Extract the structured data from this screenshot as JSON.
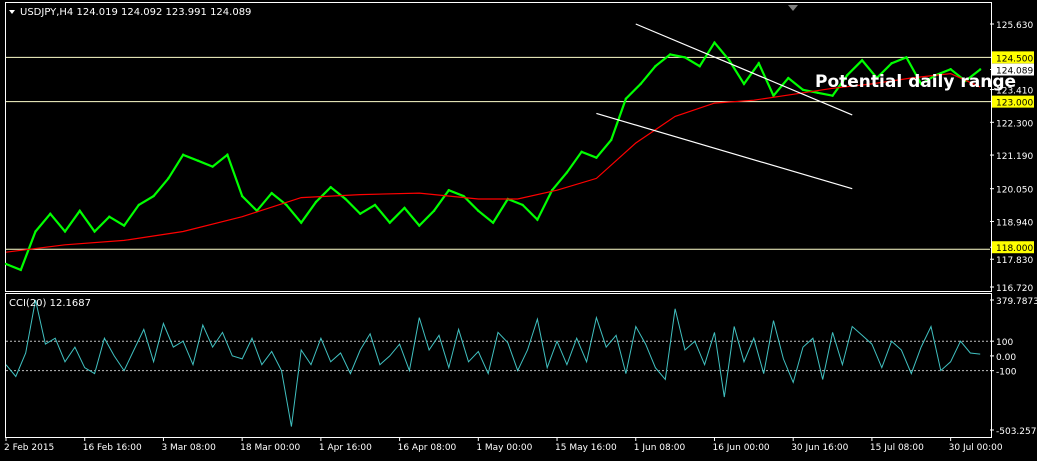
{
  "header": {
    "symbol_line": "USDJPY,H4  124.019 124.092 123.991 124.089",
    "indicator_line": "CCI(20) 12.1687"
  },
  "annotation": "Potential daily range",
  "colors": {
    "background": "#000000",
    "grid_border": "#ffffff",
    "price": "#00ff00",
    "moving_average": "#ff0000",
    "hline": "#ffffcc",
    "trendline": "#ffffff",
    "cci": "#40c0c0",
    "label_bg": "#ffff00"
  },
  "chart_data": [
    {
      "type": "line",
      "panel": "price",
      "title": "USDJPY,H4",
      "ohlc_last": {
        "open": 124.019,
        "high": 124.092,
        "low": 123.991,
        "close": 124.089
      },
      "ylim": [
        116.72,
        125.63
      ],
      "y_ticks": [
        "125.630",
        "124.500",
        "124.089",
        "123.410",
        "123.000",
        "122.300",
        "121.190",
        "120.050",
        "118.940",
        "118.000",
        "117.830",
        "116.720"
      ],
      "x_tick_labels": [
        "2 Feb 2015",
        "16 Feb 16:00",
        "3 Mar 08:00",
        "18 Mar 00:00",
        "1 Apr 16:00",
        "16 Apr 08:00",
        "1 May 00:00",
        "15 May 16:00",
        "1 Jun 08:00",
        "16 Jun 00:00",
        "30 Jun 16:00",
        "15 Jul 08:00",
        "30 Jul 00:00"
      ],
      "x_tick_index": [
        0,
        80,
        160,
        240,
        320,
        400,
        480,
        560,
        640,
        720,
        800,
        880,
        960
      ],
      "series": [
        {
          "id": "price",
          "x_index": [
            0,
            15,
            30,
            45,
            60,
            75,
            90,
            105,
            120,
            135,
            150,
            165,
            180,
            195,
            210,
            225,
            240,
            255,
            270,
            285,
            300,
            315,
            330,
            345,
            360,
            375,
            390,
            405,
            420,
            435,
            450,
            465,
            480,
            495,
            510,
            525,
            540,
            555,
            570,
            585,
            600,
            615,
            630,
            645,
            660,
            675,
            690,
            705,
            720,
            735,
            750,
            765,
            780,
            795,
            810,
            825,
            840,
            855,
            870,
            885,
            900,
            915,
            930,
            945,
            960,
            975,
            990
          ],
          "y": [
            117.5,
            117.3,
            118.6,
            119.2,
            118.6,
            119.3,
            118.6,
            119.1,
            118.8,
            119.5,
            119.8,
            120.4,
            121.2,
            121.0,
            120.8,
            121.2,
            119.8,
            119.3,
            119.9,
            119.5,
            118.9,
            119.6,
            120.1,
            119.7,
            119.2,
            119.5,
            118.9,
            119.4,
            118.8,
            119.3,
            120.0,
            119.8,
            119.3,
            118.9,
            119.7,
            119.5,
            119.0,
            120.0,
            120.6,
            121.3,
            121.1,
            121.7,
            123.1,
            123.6,
            124.2,
            124.6,
            124.5,
            124.2,
            125.0,
            124.4,
            123.6,
            124.3,
            123.2,
            123.8,
            123.4,
            123.3,
            123.2,
            123.9,
            124.4,
            123.8,
            124.3,
            124.5,
            123.6,
            123.9,
            124.1,
            123.7,
            124.089
          ]
        },
        {
          "id": "moving_average",
          "x_index": [
            0,
            60,
            120,
            180,
            240,
            300,
            360,
            420,
            480,
            520,
            560,
            600,
            640,
            680,
            720,
            760,
            800,
            840,
            880,
            920,
            960,
            990
          ],
          "y": [
            117.9,
            118.15,
            118.3,
            118.6,
            119.1,
            119.75,
            119.85,
            119.9,
            119.7,
            119.7,
            120.0,
            120.4,
            121.6,
            122.5,
            122.95,
            123.05,
            123.25,
            123.45,
            123.6,
            123.8,
            123.95,
            123.5
          ]
        }
      ],
      "horizontal_lines": [
        124.5,
        123.0,
        118.0
      ],
      "trendlines": [
        {
          "from": [
            640,
            125.63
          ],
          "to": [
            860,
            122.55
          ]
        },
        {
          "from": [
            600,
            122.6
          ],
          "to": [
            860,
            120.05
          ]
        }
      ]
    },
    {
      "type": "line",
      "panel": "indicator",
      "title": "CCI(20) 12.1687",
      "ylim": [
        -503.2579,
        379.7873
      ],
      "y_ticks": [
        "379.7873",
        "100",
        "0.00",
        "-100",
        "-503.2579"
      ],
      "levels": [
        100,
        -100
      ],
      "series": [
        {
          "id": "cci",
          "x_index": [
            0,
            10,
            20,
            30,
            40,
            50,
            60,
            70,
            80,
            90,
            100,
            110,
            120,
            130,
            140,
            150,
            160,
            170,
            180,
            190,
            200,
            210,
            220,
            230,
            240,
            250,
            260,
            270,
            280,
            290,
            300,
            310,
            320,
            330,
            340,
            350,
            360,
            370,
            380,
            390,
            400,
            410,
            420,
            430,
            440,
            450,
            460,
            470,
            480,
            490,
            500,
            510,
            520,
            530,
            540,
            550,
            560,
            570,
            580,
            590,
            600,
            610,
            620,
            630,
            640,
            650,
            660,
            670,
            680,
            690,
            700,
            710,
            720,
            730,
            740,
            750,
            760,
            770,
            780,
            790,
            800,
            810,
            820,
            830,
            840,
            850,
            860,
            870,
            880,
            890,
            900,
            910,
            920,
            930,
            940,
            950,
            960,
            970,
            980,
            990
          ],
          "y": [
            -60,
            -140,
            20,
            380,
            80,
            120,
            -40,
            60,
            -80,
            -120,
            120,
            0,
            -100,
            40,
            180,
            -40,
            220,
            60,
            100,
            -60,
            210,
            60,
            160,
            0,
            -20,
            120,
            -60,
            30,
            -100,
            -480,
            40,
            -60,
            120,
            -40,
            20,
            -120,
            40,
            150,
            -60,
            0,
            80,
            -100,
            260,
            40,
            140,
            -80,
            180,
            -40,
            30,
            -120,
            160,
            90,
            -100,
            40,
            250,
            -80,
            100,
            -60,
            120,
            -40,
            260,
            60,
            140,
            -120,
            200,
            80,
            -80,
            -160,
            320,
            40,
            100,
            -60,
            160,
            -280,
            200,
            -40,
            120,
            -120,
            240,
            -20,
            -180,
            60,
            120,
            -160,
            160,
            -60,
            200,
            140,
            80,
            -80,
            100,
            40,
            -120,
            60,
            200,
            -100,
            -40,
            100,
            20,
            12.1687
          ]
        }
      ]
    }
  ]
}
